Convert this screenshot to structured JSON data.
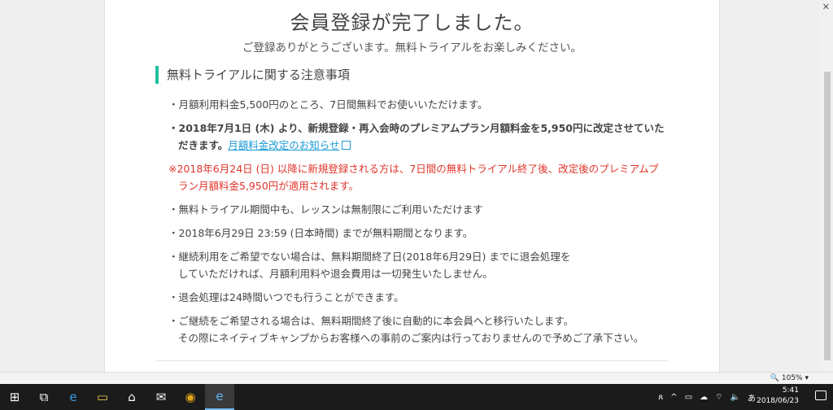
{
  "page": {
    "title": "会員登録が完了しました。",
    "subtitle": "ご登録ありがとうございます。無料トライアルをお楽しみください。",
    "section_heading": "無料トライアルに関する注意事項",
    "accent_color": "#21c1a0",
    "warning_color": "#e0352b",
    "link_color": "#1a9ad6"
  },
  "notes": {
    "n1": "・月額利用料金5,500円のところ、7日間無料でお使いいただけます。",
    "n2_line1": "・2018年7月1日 (木) より、新規登録・再入会時のプレミアムプラン月額料金を5,950円に改定させていた",
    "n2_line2": "だきます。",
    "n2_link": "月額料金改定のお知らせ",
    "n3_line1": "※2018年6月24日 (日) 以降に新規登録される方は、7日間の無料トライアル終了後、改定後のプレミアムプ",
    "n3_line2": "ラン月額料金5,950円が適用されます。",
    "n4": "・無料トライアル期間中も、レッスンは無制限にご利用いただけます",
    "n5": "・2018年6月29日 23:59 (日本時間) までが無料期間となります。",
    "n6_line1": "・継続利用をご希望でない場合は、無料期間終了日(2018年6月29日) までに退会処理を",
    "n6_line2": "していただければ、月額利用料や退会費用は一切発生いたしません。",
    "n7": "・退会処理は24時間いつでも行うことができます。",
    "n8_line1": "・ご継続をご希望される場合は、無料期間終了後に自動的に本会員へと移行いたします。",
    "n8_line2": "その際にネイティブキャンプからお客様への事前のご案内は行っておりませんので予めご了承下さい。"
  },
  "browser": {
    "zoom": "105%",
    "close_glyph": "✕"
  },
  "taskbar": {
    "time": "5:41",
    "date": "2018/06/23",
    "icons": {
      "start": "⊞",
      "taskview": "⧉",
      "edge": "e",
      "explorer": "▭",
      "store": "⌂",
      "mail": "✉",
      "chrome": "◉",
      "ie": "e"
    },
    "tray": {
      "people": "ጸ",
      "chevron": "^",
      "battery": "▭",
      "cloud": "☁",
      "wifi": "⌔",
      "volume": "🔈",
      "ime": "あ"
    }
  }
}
